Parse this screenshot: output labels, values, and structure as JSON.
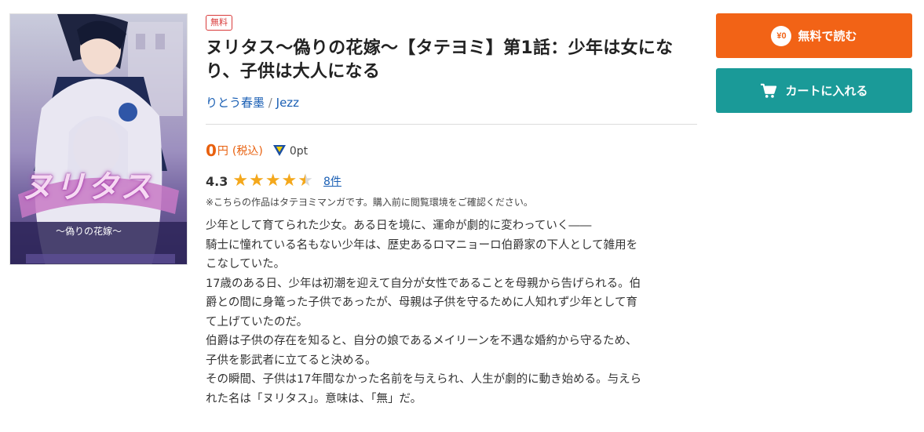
{
  "cover": {
    "title_overlay": "ヌリタス",
    "subtitle_overlay": "～偽りの花嫁～"
  },
  "badge": "無料",
  "title": "ヌリタス～偽りの花嫁～【タテヨミ】第1話：少年は女になり、子供は大人になる",
  "authors": [
    "りとう春墨",
    "Jezz"
  ],
  "author_separator": "/",
  "price": {
    "amount": "0",
    "unit": "円",
    "tax": "(税込)",
    "points": "0pt"
  },
  "rating": {
    "value": "4.3",
    "stars": 4.3,
    "count": "8件"
  },
  "note": "※こちらの作品はタテヨミマンガです。購入前に閲覧環境をご確認ください。",
  "description": [
    "少年として育てられた少女。ある日を境に、運命が劇的に変わっていく――",
    "騎士に憧れている名もない少年は、歴史あるロマニョーロ伯爵家の下人として雑用を",
    "こなしていた。",
    "17歳のある日、少年は初潮を迎えて自分が女性であることを母親から告げられる。伯",
    "爵との間に身篭った子供であったが、母親は子供を守るために人知れず少年として育",
    "て上げていたのだ。",
    "伯爵は子供の存在を知ると、自分の娘であるメイリーンを不遇な婚約から守るため、",
    "子供を影武者に立てると決める。",
    "その瞬間、子供は17年間なかった名前を与えられ、人生が劇的に動き始める。与えら",
    "れた名は「ヌリタス」。意味は、「無」だ。"
  ],
  "actions": {
    "free_read": {
      "icon_text": "¥0",
      "label": "無料で読む"
    },
    "add_cart": {
      "label": "カートに入れる"
    }
  },
  "colors": {
    "accent_orange": "#f26316",
    "accent_teal": "#1a9a98",
    "price_orange": "#e8600e",
    "link_blue": "#1a5fb4",
    "star": "#f4a81c",
    "badge_red": "#d93b3b"
  }
}
